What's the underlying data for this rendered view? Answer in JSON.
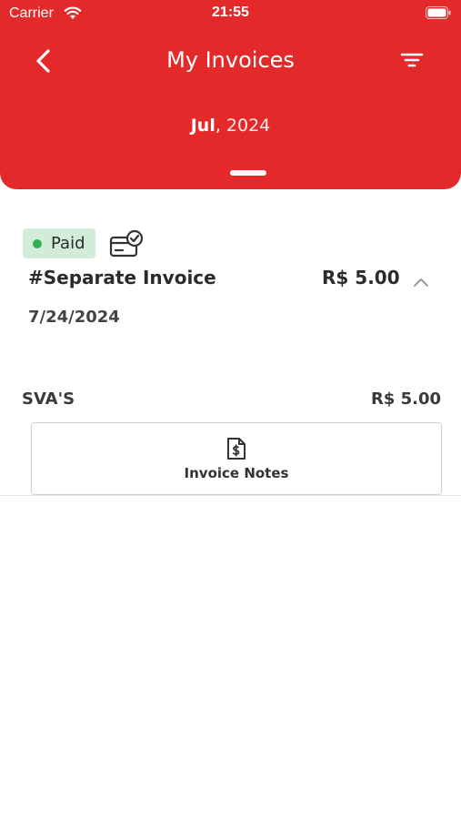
{
  "status_bar": {
    "carrier": "Carrier",
    "time": "21:55"
  },
  "header": {
    "title": "My Invoices",
    "month": "Jul",
    "separator": ",",
    "year": "2024",
    "background_color": "#e4292b"
  },
  "invoice": {
    "status": "Paid",
    "status_color": "#32b04f",
    "title": "#Separate Invoice",
    "amount": "R$ 5.00",
    "date": "7/24/2024",
    "payment_icon": "credit-card-check-icon"
  },
  "items": [
    {
      "name": "SVA'S",
      "amount": "R$ 5.00"
    }
  ],
  "notes_button": {
    "label": "Invoice Notes",
    "icon": "document-dollar-icon"
  }
}
